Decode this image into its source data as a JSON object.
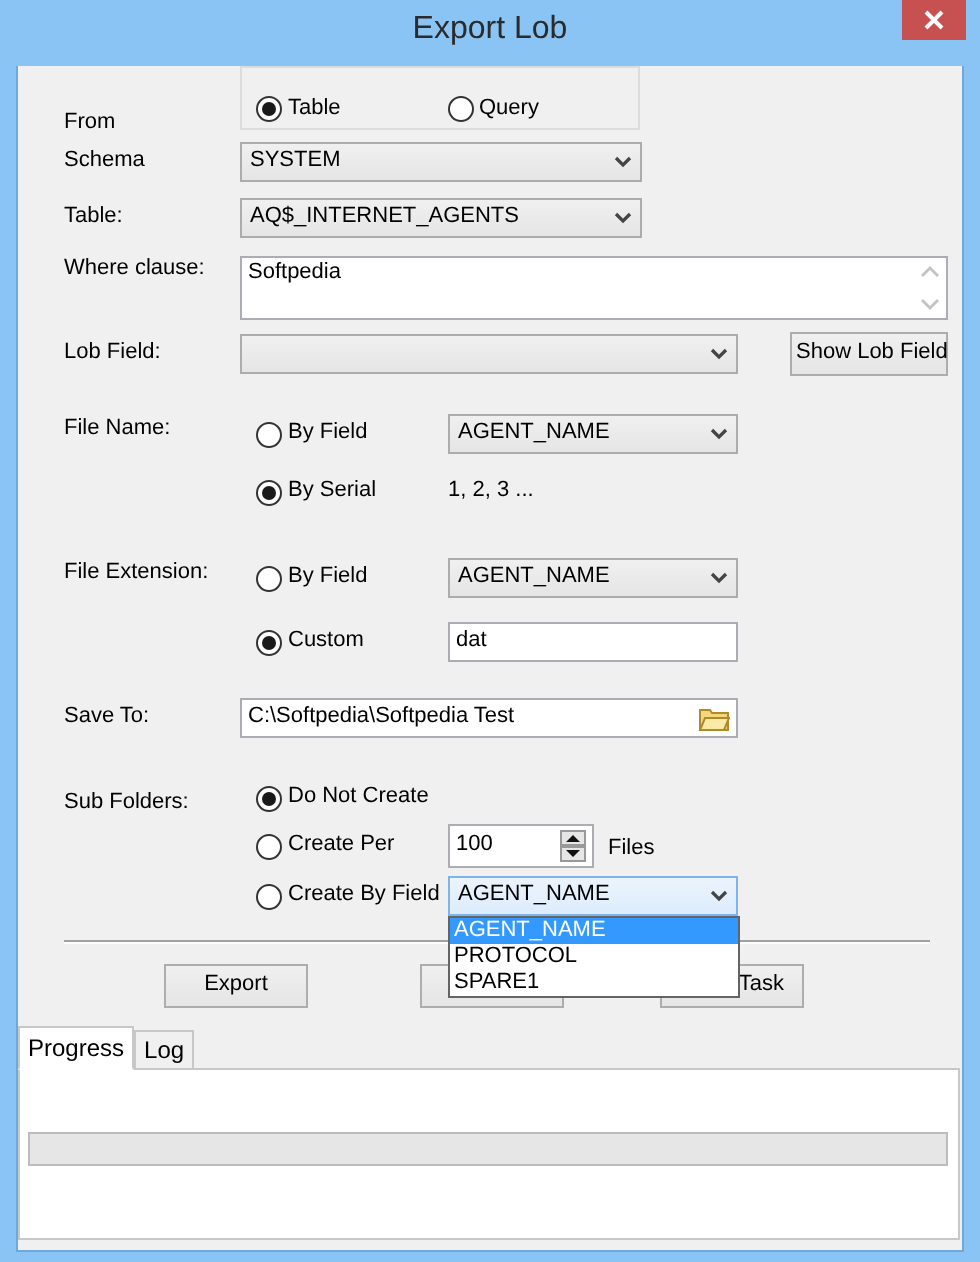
{
  "window": {
    "title": "Export Lob"
  },
  "from": {
    "label": "From",
    "options": [
      {
        "label": "Table",
        "selected": true
      },
      {
        "label": "Query",
        "selected": false
      }
    ]
  },
  "schema": {
    "label": "Schema",
    "value": "SYSTEM"
  },
  "table": {
    "label": "Table:",
    "value": "AQ$_INTERNET_AGENTS"
  },
  "where_clause": {
    "label": "Where clause:",
    "value": "Softpedia"
  },
  "lob_field": {
    "label": "Lob Field:",
    "button": "Show Lob Field"
  },
  "file_name": {
    "label": "File Name:",
    "options": [
      {
        "label": "By Field",
        "selected": false,
        "kind": "select",
        "value": "AGENT_NAME"
      },
      {
        "label": "By Serial",
        "selected": true,
        "kind": "text",
        "value": "1, 2, 3 ..."
      }
    ]
  },
  "file_extension": {
    "label": "File Extension:",
    "options": [
      {
        "label": "By Field",
        "selected": false,
        "kind": "select",
        "value": "AGENT_NAME"
      },
      {
        "label": "Custom",
        "selected": true,
        "kind": "input",
        "value": "dat"
      }
    ]
  },
  "save_to": {
    "label": "Save To:",
    "value": "C:\\Softpedia\\Softpedia Test"
  },
  "sub_folders": {
    "label": "Sub Folders:",
    "options": [
      {
        "label": "Do Not Create",
        "selected": true,
        "kind": "none"
      },
      {
        "label": "Create Per",
        "selected": false,
        "kind": "spin",
        "value": "100",
        "suffix": "Files"
      },
      {
        "label": "Create By Field",
        "selected": false,
        "kind": "select",
        "value": "AGENT_NAME",
        "expanded": true,
        "list": [
          {
            "label": "AGENT_NAME",
            "selected": true
          },
          {
            "label": "PROTOCOL",
            "selected": false
          },
          {
            "label": "SPARE1",
            "selected": false
          }
        ]
      }
    ]
  },
  "buttons": [
    {
      "kind": "full",
      "label": "Export"
    },
    {
      "kind": "covered"
    },
    {
      "kind": "partial",
      "label": "Task"
    }
  ],
  "tabs": [
    {
      "label": "Progress",
      "selected": true
    },
    {
      "label": "Log",
      "selected": false
    }
  ],
  "progress": {
    "level": 0
  }
}
